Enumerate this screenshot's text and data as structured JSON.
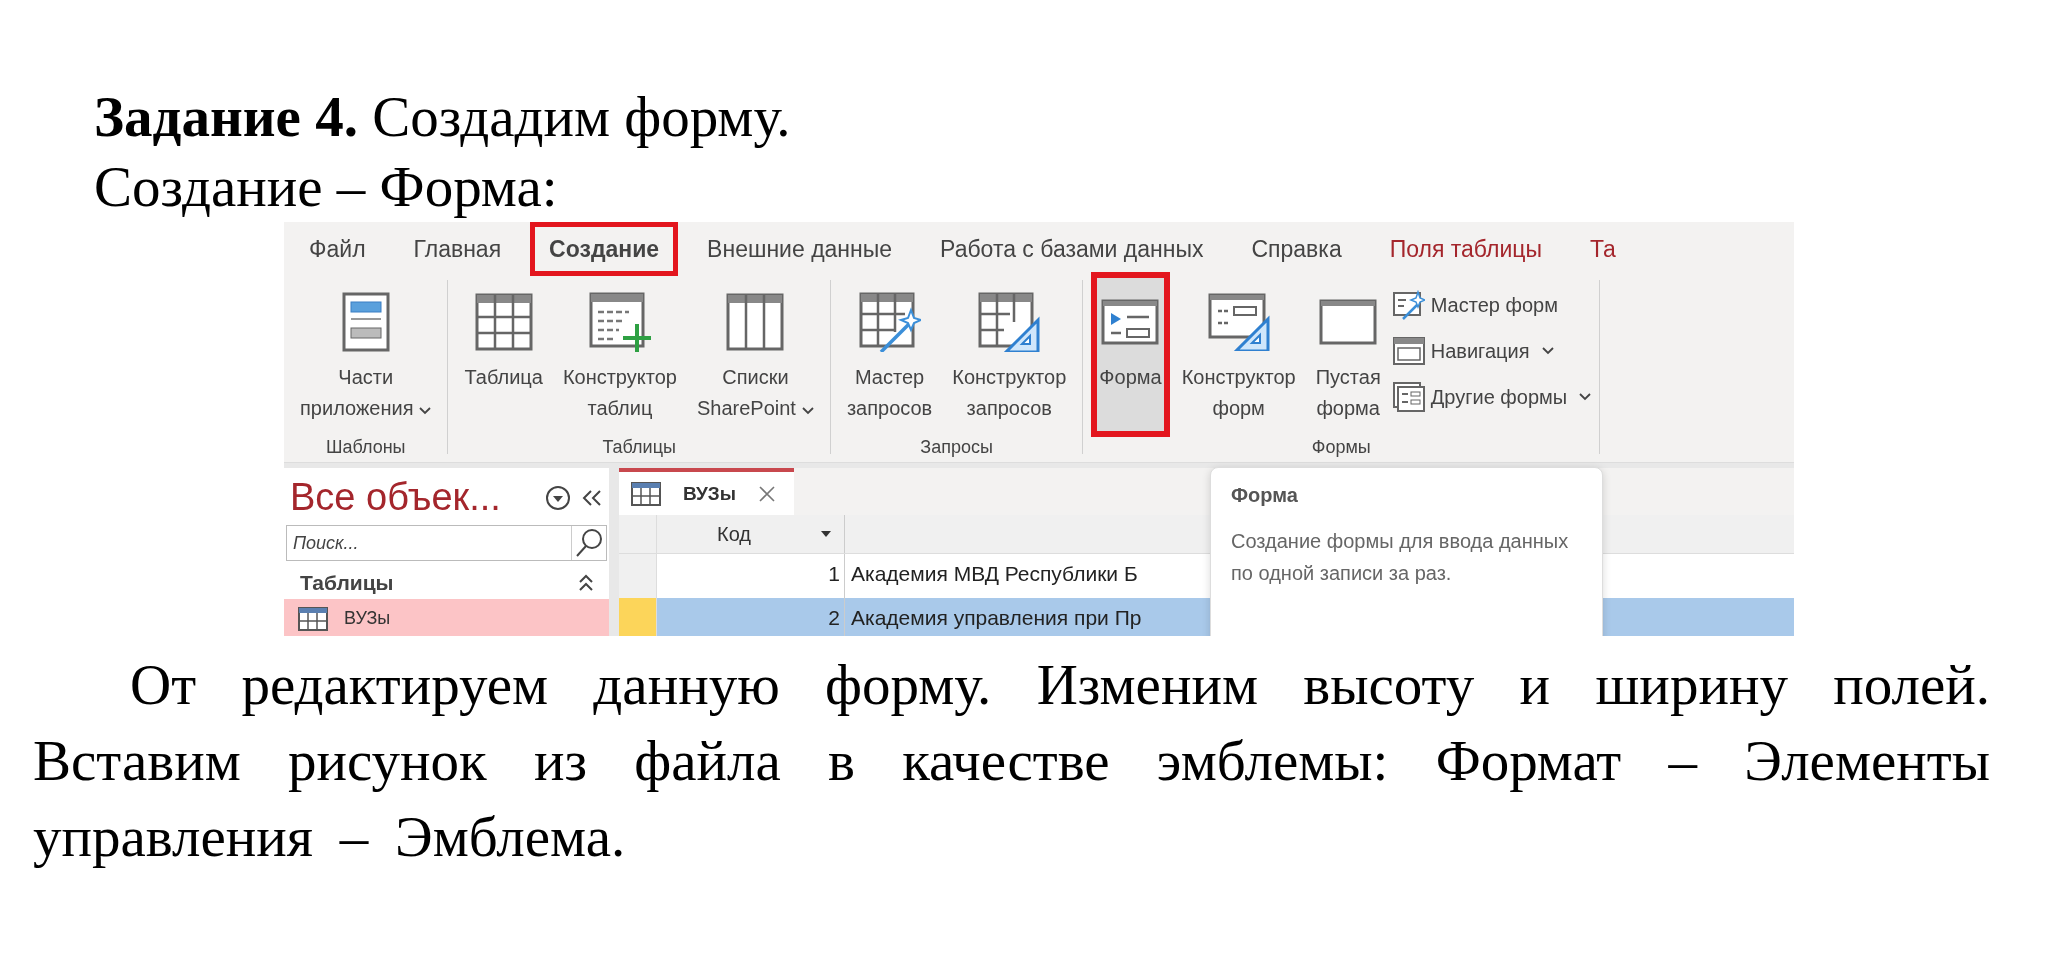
{
  "heading": "**Задание 4.** Создадим форму.",
  "subheading": "Создание – Форма:",
  "app": {
    "tabs": [
      {
        "label": "Файл",
        "selected": false,
        "contextual": false
      },
      {
        "label": "Главная",
        "selected": false,
        "contextual": false
      },
      {
        "label": "Создание",
        "selected": true,
        "highlighted": true,
        "contextual": false
      },
      {
        "label": "Внешние данные",
        "selected": false,
        "contextual": false
      },
      {
        "label": "Работа с базами данных",
        "selected": false,
        "contextual": false
      },
      {
        "label": "Справка",
        "selected": false,
        "contextual": false
      },
      {
        "label": "Поля таблицы",
        "selected": false,
        "contextual": true
      },
      {
        "label": "Та",
        "selected": false,
        "contextual": true
      }
    ],
    "groups": [
      {
        "label": "Шаблоны",
        "buttons": [
          {
            "kind": "large",
            "lines": [
              "Части",
              "приложения"
            ],
            "dropdown": true
          }
        ]
      },
      {
        "label": "Таблицы",
        "buttons": [
          {
            "kind": "large",
            "lines": [
              "Таблица"
            ]
          },
          {
            "kind": "large",
            "lines": [
              "Конструктор",
              "таблиц"
            ]
          },
          {
            "kind": "large",
            "lines": [
              "Списки",
              "SharePoint"
            ],
            "dropdown": true
          }
        ]
      },
      {
        "label": "Запросы",
        "buttons": [
          {
            "kind": "large",
            "lines": [
              "Мастер",
              "запросов"
            ]
          },
          {
            "kind": "large",
            "lines": [
              "Конструктор",
              "запросов"
            ]
          }
        ]
      },
      {
        "label": "Формы",
        "buttons": [
          {
            "kind": "large",
            "lines": [
              "Форма"
            ],
            "hovered": true,
            "highlighted": true
          },
          {
            "kind": "large",
            "lines": [
              "Конструктор",
              "форм"
            ]
          },
          {
            "kind": "large",
            "lines": [
              "Пустая",
              "форма"
            ]
          },
          {
            "kind": "small",
            "lines": [
              "Мастер форм"
            ]
          },
          {
            "kind": "small",
            "lines": [
              "Навигация"
            ],
            "dropdown": true
          },
          {
            "kind": "small",
            "lines": [
              "Другие формы"
            ],
            "dropdown": true
          }
        ]
      }
    ],
    "navigation_pane": {
      "title": "Все объек...",
      "search": {
        "placeholder": "Поиск..."
      },
      "section": {
        "label": "Таблицы",
        "expanded": true
      },
      "items": [
        {
          "label": "ВУЗы",
          "selected": true
        }
      ]
    },
    "document_tab": {
      "label": "ВУЗы"
    },
    "table": {
      "columns": [
        "Код"
      ],
      "rows": [
        {
          "cells": [
            "1",
            "Академия МВД Республики Б"
          ],
          "selected": false
        },
        {
          "cells": [
            "2",
            "Академия управления при Пр"
          ],
          "selected": true
        }
      ]
    },
    "tooltip": {
      "title": "Форма",
      "text": "Создание формы для ввода данных по одной записи за раз."
    }
  },
  "paragraph": "От редактируем данную форму. Изменим высоту и ширину полей. Вставим рисунок из файла в качестве эмблемы: Формат – Элементы управления – Эмблема."
}
